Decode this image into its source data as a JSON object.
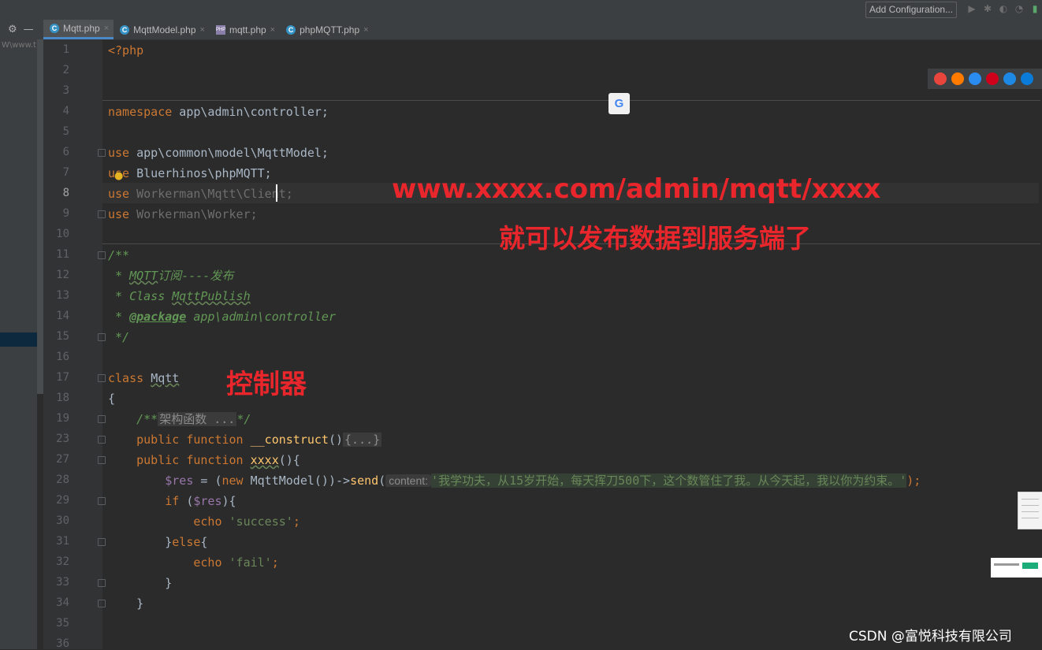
{
  "toolbar": {
    "run_config": "Add Configuration...",
    "icons": [
      "run-icon",
      "debug-icon",
      "coverage-icon",
      "profile-icon",
      "build-icon"
    ]
  },
  "project_panel": {
    "path": "W\\www.t"
  },
  "tabs": [
    {
      "label": "Mqtt.php",
      "type": "class",
      "active": true
    },
    {
      "label": "MqttModel.php",
      "type": "class",
      "active": false
    },
    {
      "label": "mqtt.php",
      "type": "php",
      "active": false
    },
    {
      "label": "phpMQTT.php",
      "type": "class",
      "active": false
    }
  ],
  "gutter": {
    "line_numbers": [
      "1",
      "2",
      "3",
      "4",
      "5",
      "6",
      "7",
      "8",
      "9",
      "10",
      "11",
      "12",
      "13",
      "14",
      "15",
      "16",
      "17",
      "18",
      "19",
      "23",
      "27",
      "28",
      "29",
      "30",
      "31",
      "32",
      "33",
      "34",
      "35",
      "36"
    ],
    "current": "8"
  },
  "code": {
    "l1": "<?php",
    "l4_kw": "namespace",
    "l4_rest": " app\\admin\\controller;",
    "l6_kw": "use",
    "l6_rest": " app\\common\\model\\MqttModel;",
    "l7_kw": "use",
    "l7_rest": " Bluerhinos\\phpMQTT;",
    "l8_kw": "use",
    "l8_rest": " Workerman\\Mqtt\\Client;",
    "l9_kw": "use",
    "l9_rest": " Workerman\\Worker;",
    "l11": "/**",
    "l12_a": " * ",
    "l12_b": "MQTT",
    "l12_c": "订阅----发布",
    "l13_a": " * Class ",
    "l13_b": "MqttPublish",
    "l14_a": " * ",
    "l14_tag": "@package",
    "l14_rest": " app\\admin\\controller",
    "l15": " */",
    "l17_kw": "class",
    "l17_name": "Mqtt",
    "l18": "{",
    "l19_a": "    /**",
    "l19_fold": "架构函数 ...",
    "l19_b": "*/",
    "l23_kw": "    public function",
    "l23_fn": " __construct",
    "l23_paren": "()",
    "l23_fold": "{...}",
    "l27_kw": "    public function",
    "l27_fn": "xxxx",
    "l27_rest": "(){",
    "l28_var": "        $res",
    "l28_eq": " = (",
    "l28_new": "new",
    "l28_cls": " MqttModel())->",
    "l28_fn": "send",
    "l28_open": "(",
    "l28_hint": "content:",
    "l28_str": "'我学功夫，从15岁开始，每天挥刀500下，这个数管住了我。从今天起，我以你为约束。'",
    "l28_close": ");",
    "l29_kw": "        if",
    "l29_a": " (",
    "l29_var": "$res",
    "l29_b": "){",
    "l30_kw": "            echo",
    "l30_str": " 'success'",
    "l30_end": ";",
    "l31_a": "        }",
    "l31_kw": "else",
    "l31_b": "{",
    "l32_kw": "            echo",
    "l32_str": " 'fail'",
    "l32_end": ";",
    "l33": "        }",
    "l34": "    }"
  },
  "annotations": {
    "url": "www.xxxx.com/admin/mqtt/xxxx",
    "publish": "就可以发布数据到服务端了",
    "controller": "控制器"
  },
  "browser_icons": [
    {
      "name": "chrome-icon",
      "color": "#e8453c"
    },
    {
      "name": "firefox-icon",
      "color": "#ff7b00"
    },
    {
      "name": "safari-icon",
      "color": "#2a8cf0"
    },
    {
      "name": "opera-icon",
      "color": "#d0021b"
    },
    {
      "name": "ie-icon",
      "color": "#1e88e5"
    },
    {
      "name": "edge-icon",
      "color": "#0a7bd8"
    }
  ],
  "translate_icon": "G",
  "watermark": "CSDN @富悦科技有限公司"
}
